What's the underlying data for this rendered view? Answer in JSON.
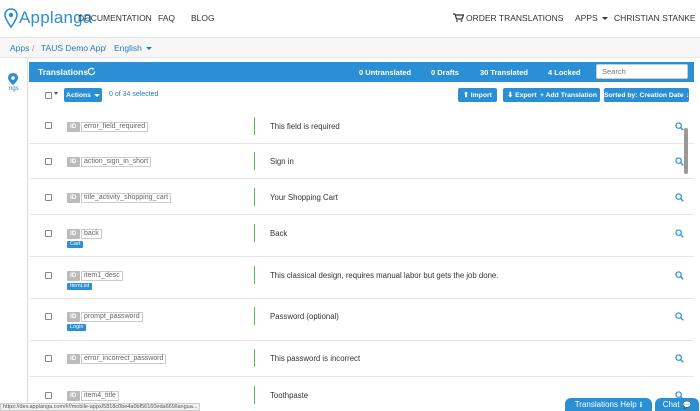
{
  "nav": {
    "logo": "Applanga",
    "links": [
      {
        "label": "DOCUMENTATION"
      },
      {
        "label": "FAQ"
      },
      {
        "label": "BLOG"
      }
    ],
    "order": "ORDER TRANSLATIONS",
    "apps": "APPS",
    "user": "CHRISTIAN STANKE"
  },
  "breadcrumb": {
    "apps": "Apps",
    "app": "TAUS Demo App",
    "language": "English"
  },
  "rail": {
    "label": "ngs"
  },
  "panel": {
    "title": "Translations",
    "untranslated": "0 Untranslated",
    "drafts": "0 Drafts",
    "translated": "30 Translated",
    "locked": "4 Locked",
    "search_placeholder": "Search"
  },
  "toolbar": {
    "actions": "Actions",
    "selected": "0 of 34 selected",
    "import": "Import",
    "export": "Export",
    "add": "+ Add Translation",
    "sorted": "Sorted by: Creation Date"
  },
  "rows": [
    {
      "id": "ID",
      "key": "error_field_required",
      "tag": "",
      "text": "This field is required"
    },
    {
      "id": "ID",
      "key": "action_sign_in_short",
      "tag": "",
      "text": "Sign in"
    },
    {
      "id": "ID",
      "key": "title_activity_shopping_cart",
      "tag": "",
      "text": "Your Shopping Cart"
    },
    {
      "id": "ID",
      "key": "back",
      "tag": "Cart",
      "text": "Back"
    },
    {
      "id": "ID",
      "key": "item1_desc",
      "tag": "ItemList",
      "text": "This classical design, requires manual labor but gets the job done."
    },
    {
      "id": "ID",
      "key": "prompt_password",
      "tag": "Login",
      "text": "Password (optional)"
    },
    {
      "id": "ID",
      "key": "error_incorrect_password",
      "tag": "",
      "text": "This password is incorrect"
    },
    {
      "id": "ID",
      "key": "item4_title",
      "tag": "",
      "text": "Toothpaste"
    }
  ],
  "status_url": "https://dev.applanga.com/#!/mobile-apps/5818c0be4a0bf56160eda669/langua...",
  "help": {
    "translations_help": "Translations Help",
    "chat": "Chat"
  },
  "colors": {
    "accent": "#2a8fd4",
    "ok": "#5cb85c"
  }
}
